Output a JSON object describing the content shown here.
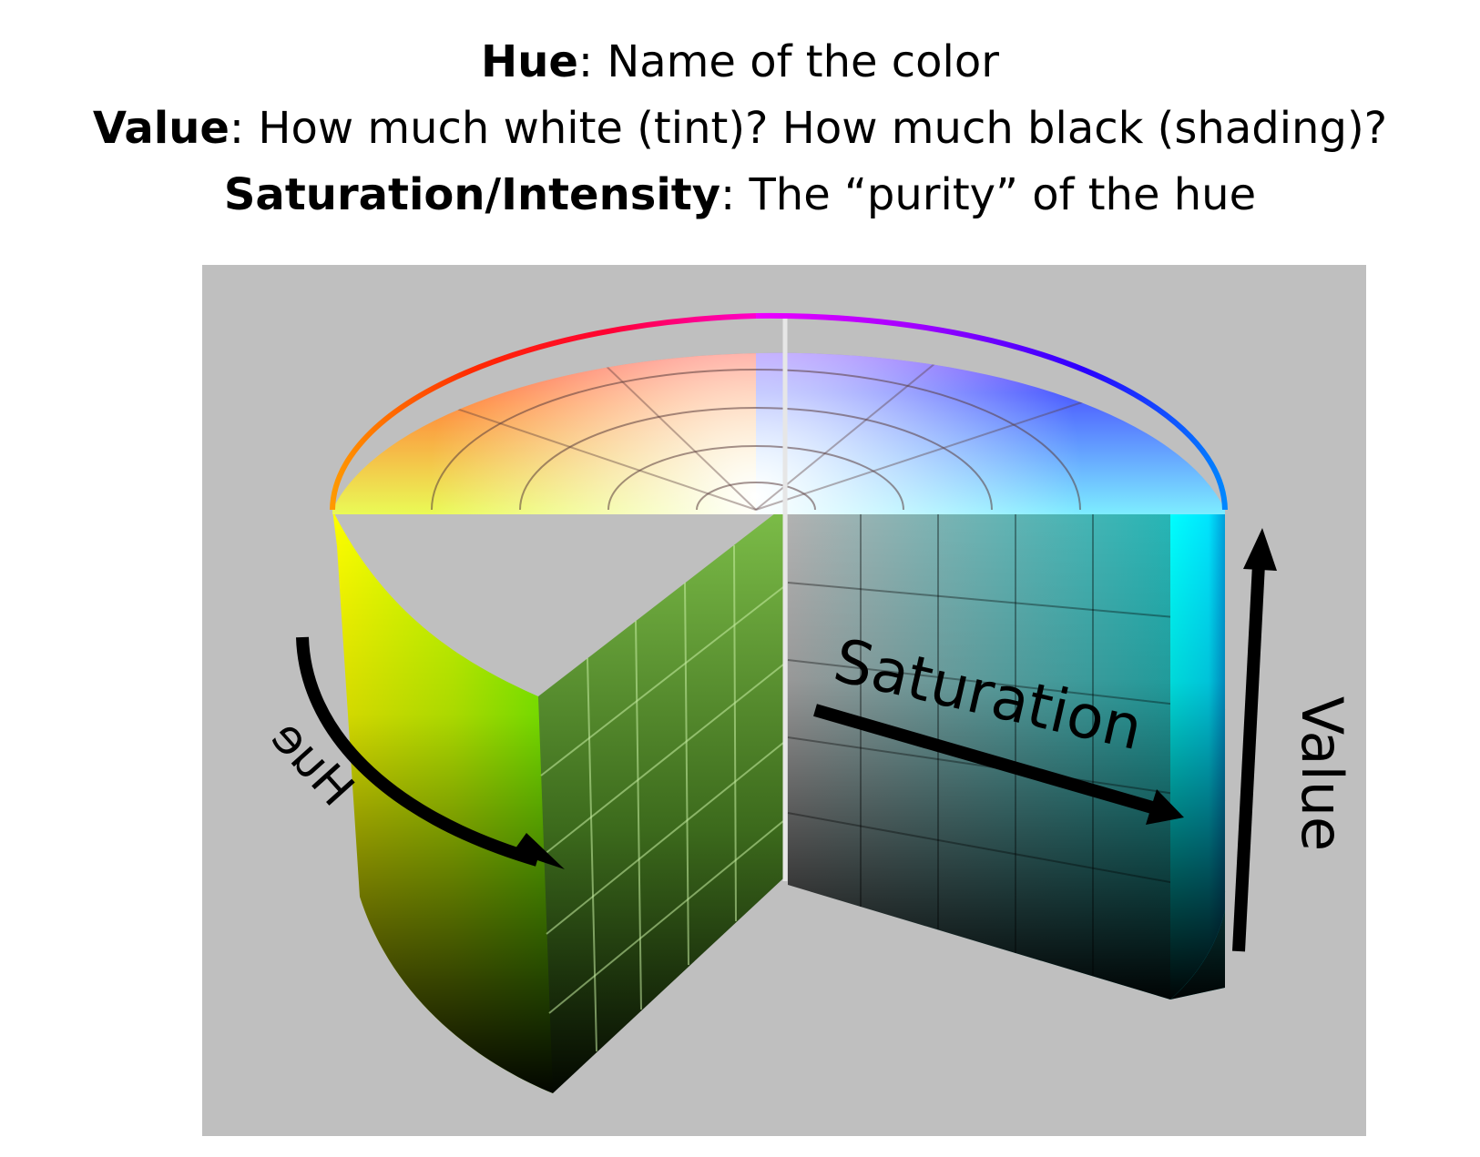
{
  "header": {
    "hue_term": "Hue",
    "hue_desc": ": Name of the color",
    "value_term": "Value",
    "value_desc": ": How much white (tint)? How much black (shading)?",
    "saturation_term": "Saturation/Intensity",
    "saturation_desc": ": The “purity” of the hue"
  },
  "diagram": {
    "labels": {
      "hue": "Hue",
      "saturation": "Saturation",
      "value": "Value"
    },
    "colors": {
      "panel_background": "#bfbfbf",
      "arrows": "#000000",
      "red": "#ff0000",
      "yellow": "#ffff00",
      "green": "#80ff00",
      "cyan": "#00ffff",
      "blue": "#0000ff",
      "magenta": "#ff00ff"
    }
  }
}
